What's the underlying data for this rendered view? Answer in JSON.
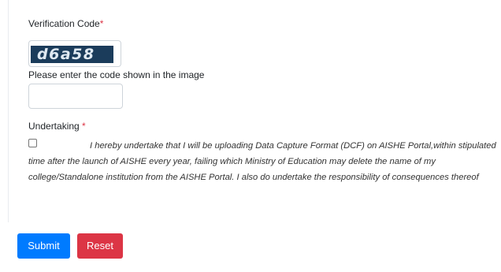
{
  "verification": {
    "label": "Verification Code",
    "required_mark": "*",
    "captcha_text": "d6a58",
    "hint": "Please enter the code shown in the image",
    "input_value": "",
    "input_placeholder": ""
  },
  "undertaking": {
    "label": "Undertaking",
    "required_mark": " *",
    "checked": false,
    "text": "I hereby undertake that I will be uploading Data Capture Format (DCF) on AISHE Portal,within stipulated time after the launch of AISHE every year, failing which Ministry of Education may delete the name of my college/Standalone institution from the AISHE Portal. I also do undertake the responsibility of consequences thereof"
  },
  "actions": {
    "submit_label": "Submit",
    "reset_label": "Reset"
  },
  "colors": {
    "primary": "#007bff",
    "danger": "#dc3545",
    "captcha_bg": "#1b3c5b"
  }
}
